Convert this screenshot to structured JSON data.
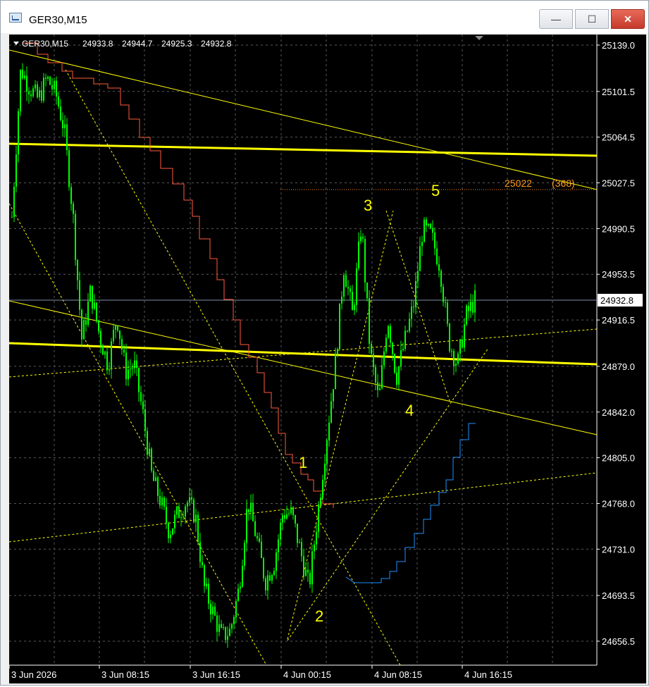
{
  "window": {
    "title": "GER30,M15",
    "minimize_glyph": "—",
    "maximize_glyph": "☐",
    "close_glyph": "✕"
  },
  "chart_info": {
    "symbol_timeframe": "GER30,M15",
    "open": "24933.8",
    "high": "24944.7",
    "low": "24925.3",
    "close": "24932.8"
  },
  "price_axis": {
    "ticks": [
      "25139.0",
      "25101.5",
      "25064.5",
      "25027.5",
      "24990.5",
      "24953.5",
      "24916.5",
      "24879.0",
      "24842.0",
      "24805.0",
      "24768.0",
      "24731.0",
      "24693.5",
      "24656.5"
    ],
    "current_price": "24932.8"
  },
  "time_axis": {
    "ticks": [
      "3 Jun 2026",
      "3 Jun 08:15",
      "3 Jun 16:15",
      "4 Jun 00:15",
      "4 Jun 08:15",
      "4 Jun 16:15"
    ]
  },
  "annotations": {
    "waves": [
      "1",
      "2",
      "3",
      "4",
      "5"
    ],
    "target_price": "25022",
    "target_points": "(368)"
  },
  "colors": {
    "candles": "#00ff00",
    "red_step": "#ff5a3c",
    "blue_step": "#1e90ff",
    "support_resistance": "#ffff00",
    "grid": "#5a5a5a",
    "target": "#ff9a1a",
    "axis_text": "#ffffff"
  },
  "icons": {
    "chart_menu": "triangle-down-icon",
    "scroll_marker": "triangle-marker-icon",
    "app": "chart-window-icon"
  },
  "chart_data": {
    "type": "candlestick",
    "x": [
      "3 Jun 2026",
      "3 Jun 08:15",
      "3 Jun 16:15",
      "4 Jun 00:15",
      "4 Jun 08:15",
      "4 Jun 16:15"
    ],
    "y_ticks": [
      25139.0,
      25101.5,
      25064.5,
      25027.5,
      24990.5,
      24953.5,
      24916.5,
      24879.0,
      24842.0,
      24805.0,
      24768.0,
      24731.0,
      24693.5,
      24656.5
    ],
    "ylim": [
      24640,
      25150
    ],
    "close_path": [
      25000,
      25120,
      25105,
      25095,
      25112,
      25100,
      25070,
      25000,
      24900,
      24940,
      24905,
      24880,
      24920,
      24875,
      24880,
      24840,
      24790,
      24770,
      24745,
      24760,
      24770,
      24758,
      24700,
      24680,
      24660,
      24665,
      24700,
      24770,
      24740,
      24705,
      24720,
      24760,
      24760,
      24730,
      24700,
      24760,
      24820,
      24880,
      24960,
      24920,
      24995,
      24890,
      24850,
      24920,
      24870,
      24900,
      24930,
      24990,
      24985,
      24960,
      24900,
      24880,
      24920,
      24932.8
    ]
  }
}
